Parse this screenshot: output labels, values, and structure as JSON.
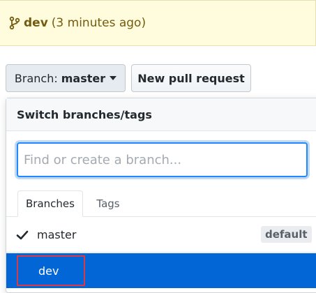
{
  "banner": {
    "branch": "dev",
    "time": "(3 minutes ago)",
    "icon": "git-branch-icon"
  },
  "toolbar": {
    "branch_prefix": "Branch:",
    "current_branch": "master",
    "new_pr_label": "New pull request"
  },
  "dropdown": {
    "title": "Switch branches/tags",
    "filter_placeholder": "Find or create a branch...",
    "tabs": [
      {
        "label": "Branches",
        "selected": true
      },
      {
        "label": "Tags",
        "selected": false
      }
    ],
    "branches": [
      {
        "name": "master",
        "checked": true,
        "badge": "default"
      },
      {
        "name": "dev",
        "highlighted": true
      }
    ]
  },
  "colors": {
    "banner_bg": "#fffbdd",
    "highlight": "#0366d6",
    "annotation_outline": "#d73a49"
  }
}
